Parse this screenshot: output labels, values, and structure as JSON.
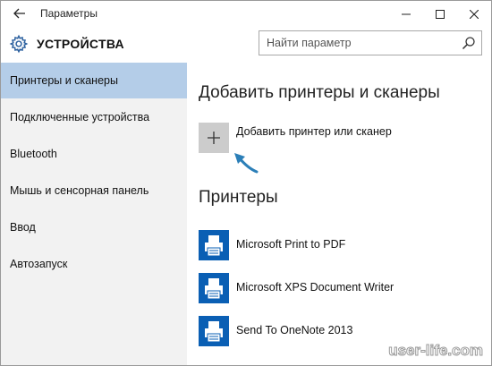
{
  "window": {
    "title": "Параметры"
  },
  "header": {
    "section_title": "УСТРОЙСТВА",
    "search_placeholder": "Найти параметр"
  },
  "sidebar": {
    "items": [
      {
        "label": "Принтеры и сканеры",
        "selected": true
      },
      {
        "label": "Подключенные устройства",
        "selected": false
      },
      {
        "label": "Bluetooth",
        "selected": false
      },
      {
        "label": "Мышь и сенсорная панель",
        "selected": false
      },
      {
        "label": "Ввод",
        "selected": false
      },
      {
        "label": "Автозапуск",
        "selected": false
      }
    ]
  },
  "main": {
    "add_heading": "Добавить принтеры и сканеры",
    "add_button_label": "Добавить принтер или сканер",
    "printers_heading": "Принтеры",
    "printers": [
      {
        "name": "Microsoft Print to PDF",
        "icon": "printer-icon"
      },
      {
        "name": "Microsoft XPS Document Writer",
        "icon": "printer-icon"
      },
      {
        "name": "Send To OneNote 2013",
        "icon": "printer-icon"
      }
    ]
  },
  "watermark": "user-life.com",
  "colors": {
    "selected_nav": "#b4cde8",
    "sidebar_bg": "#f2f2f2",
    "printer_icon": "#0a5fb4",
    "arrow": "#2c7fb8"
  }
}
